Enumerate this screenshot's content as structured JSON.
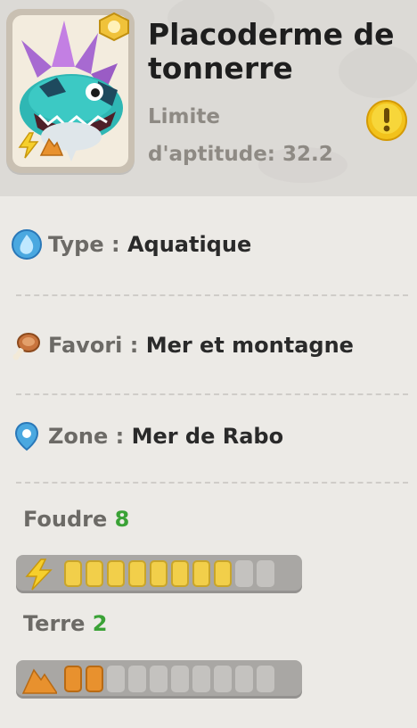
{
  "creature": {
    "name": "Placoderme de tonnerre",
    "aptitude_label": "Limite d'aptitude: 32.2",
    "elements": [
      "lightning",
      "earth"
    ]
  },
  "info": {
    "type_label": "Type : ",
    "type_value": "Aquatique",
    "favori_label": "Favori : ",
    "favori_value": "Mer et montagne",
    "zone_label": "Zone : ",
    "zone_value": "Mer de Rabo"
  },
  "stats": [
    {
      "name": "Foudre",
      "value": "8",
      "filled": 8,
      "max": 10,
      "icon": "lightning-icon",
      "color": "#f2cf4a",
      "border": "#c9a52a"
    },
    {
      "name": "Terre",
      "value": "2",
      "filled": 2,
      "max": 10,
      "icon": "mountain-icon",
      "color": "#e8912e",
      "border": "#b86a14"
    }
  ],
  "colors": {
    "accent_green": "#3aa236",
    "alert_yellow": "#f2c21b"
  }
}
